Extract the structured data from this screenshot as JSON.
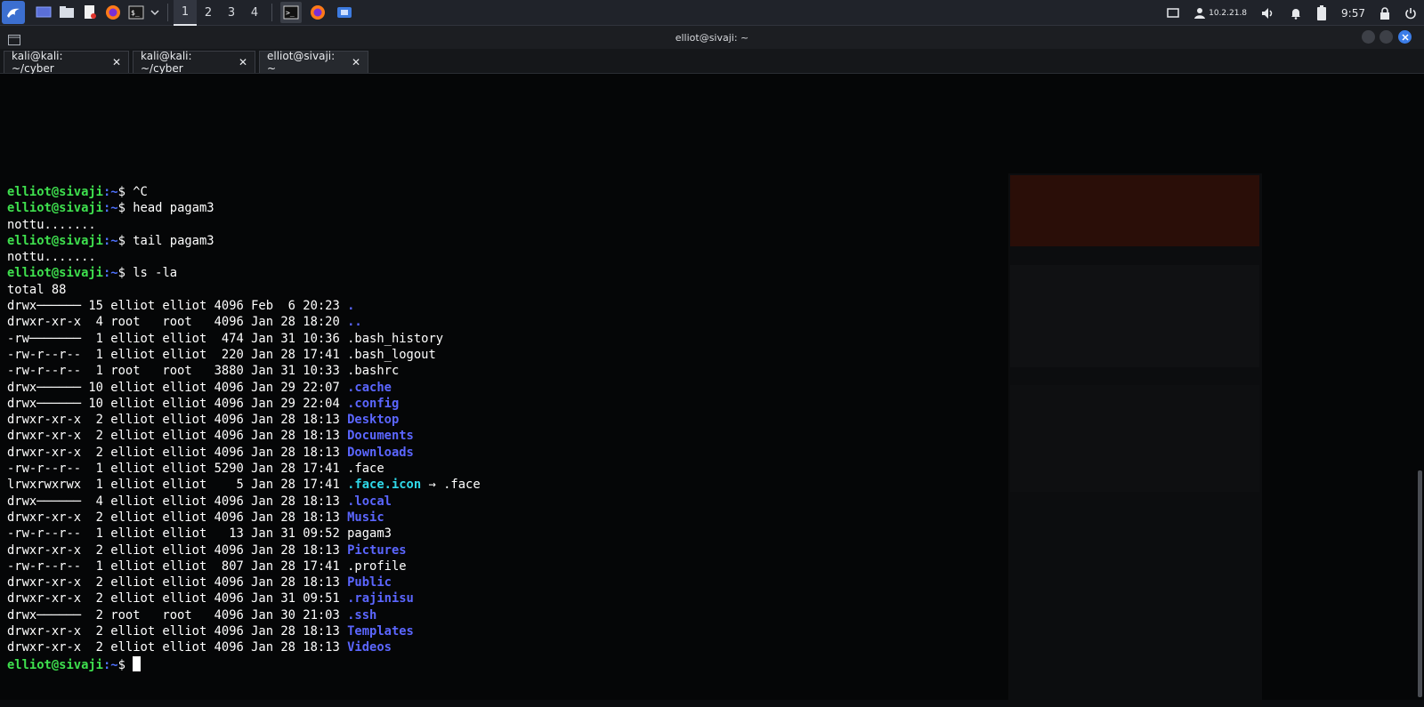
{
  "panel": {
    "workspaces": [
      "1",
      "2",
      "3",
      "4"
    ],
    "active_workspace": "1",
    "ip": "10.2.21.8",
    "clock": "9:57"
  },
  "window": {
    "title": "elliot@sivaji: ~"
  },
  "tabs": [
    {
      "label": "kali@kali: ~/cyber",
      "close": "✕"
    },
    {
      "label": "kali@kali: ~/cyber",
      "close": "✕"
    },
    {
      "label": "elliot@sivaji: ~",
      "close": "✕"
    }
  ],
  "terminal": {
    "prompt_user": "elliot@sivaji",
    "prompt_path": ":~",
    "prompt_symbol": "$ ",
    "lines": [
      {
        "type": "cmd",
        "text": "^C"
      },
      {
        "type": "cmd",
        "text": "head pagam3"
      },
      {
        "type": "out",
        "text": "nottu......."
      },
      {
        "type": "cmd",
        "text": "tail pagam3"
      },
      {
        "type": "out",
        "text": "nottu......."
      },
      {
        "type": "cmd",
        "text": "ls -la"
      },
      {
        "type": "out",
        "text": "total 88"
      },
      {
        "type": "ls",
        "meta": "drwx────── 15 elliot elliot 4096 Feb  6 20:23 ",
        "name": ".",
        "kind": "dir"
      },
      {
        "type": "ls",
        "meta": "drwxr-xr-x  4 root   root   4096 Jan 28 18:20 ",
        "name": "..",
        "kind": "dir"
      },
      {
        "type": "ls",
        "meta": "-rw───────  1 elliot elliot  474 Jan 31 10:36 ",
        "name": ".bash_history",
        "kind": "file"
      },
      {
        "type": "ls",
        "meta": "-rw-r--r--  1 elliot elliot  220 Jan 28 17:41 ",
        "name": ".bash_logout",
        "kind": "file"
      },
      {
        "type": "ls",
        "meta": "-rw-r--r--  1 root   root   3880 Jan 31 10:33 ",
        "name": ".bashrc",
        "kind": "file"
      },
      {
        "type": "ls",
        "meta": "drwx────── 10 elliot elliot 4096 Jan 29 22:07 ",
        "name": ".cache",
        "kind": "dir"
      },
      {
        "type": "ls",
        "meta": "drwx────── 10 elliot elliot 4096 Jan 29 22:04 ",
        "name": ".config",
        "kind": "dir"
      },
      {
        "type": "ls",
        "meta": "drwxr-xr-x  2 elliot elliot 4096 Jan 28 18:13 ",
        "name": "Desktop",
        "kind": "dir"
      },
      {
        "type": "ls",
        "meta": "drwxr-xr-x  2 elliot elliot 4096 Jan 28 18:13 ",
        "name": "Documents",
        "kind": "dir"
      },
      {
        "type": "ls",
        "meta": "drwxr-xr-x  2 elliot elliot 4096 Jan 28 18:13 ",
        "name": "Downloads",
        "kind": "dir"
      },
      {
        "type": "ls",
        "meta": "-rw-r--r--  1 elliot elliot 5290 Jan 28 17:41 ",
        "name": ".face",
        "kind": "file"
      },
      {
        "type": "ls",
        "meta": "lrwxrwxrwx  1 elliot elliot    5 Jan 28 17:41 ",
        "name": ".face.icon",
        "kind": "link",
        "target": " → .face"
      },
      {
        "type": "ls",
        "meta": "drwx──────  4 elliot elliot 4096 Jan 28 18:13 ",
        "name": ".local",
        "kind": "dir"
      },
      {
        "type": "ls",
        "meta": "drwxr-xr-x  2 elliot elliot 4096 Jan 28 18:13 ",
        "name": "Music",
        "kind": "dir"
      },
      {
        "type": "ls",
        "meta": "-rw-r--r--  1 elliot elliot   13 Jan 31 09:52 ",
        "name": "pagam3",
        "kind": "file"
      },
      {
        "type": "ls",
        "meta": "drwxr-xr-x  2 elliot elliot 4096 Jan 28 18:13 ",
        "name": "Pictures",
        "kind": "dir"
      },
      {
        "type": "ls",
        "meta": "-rw-r--r--  1 elliot elliot  807 Jan 28 17:41 ",
        "name": ".profile",
        "kind": "file"
      },
      {
        "type": "ls",
        "meta": "drwxr-xr-x  2 elliot elliot 4096 Jan 28 18:13 ",
        "name": "Public",
        "kind": "dir"
      },
      {
        "type": "ls",
        "meta": "drwxr-xr-x  2 elliot elliot 4096 Jan 31 09:51 ",
        "name": ".rajinisu",
        "kind": "dir"
      },
      {
        "type": "ls",
        "meta": "drwx──────  2 root   root   4096 Jan 30 21:03 ",
        "name": ".ssh",
        "kind": "dir"
      },
      {
        "type": "ls",
        "meta": "drwxr-xr-x  2 elliot elliot 4096 Jan 28 18:13 ",
        "name": "Templates",
        "kind": "dir"
      },
      {
        "type": "ls",
        "meta": "drwxr-xr-x  2 elliot elliot 4096 Jan 28 18:13 ",
        "name": "Videos",
        "kind": "dir"
      },
      {
        "type": "prompt",
        "text": ""
      }
    ]
  },
  "colors": {
    "prompt_user": "#3ee04e",
    "prompt_path": "#4e71ff",
    "directory": "#5b66ff",
    "symlink": "#2fd8e8",
    "background": "#050607"
  },
  "icons": {
    "menu": "kali-dragon-icon",
    "show_desktop": "desktop-icon",
    "files": "folder-icon",
    "editor": "text-editor-icon",
    "browser": "firefox-icon",
    "terminal": "terminal-icon"
  }
}
